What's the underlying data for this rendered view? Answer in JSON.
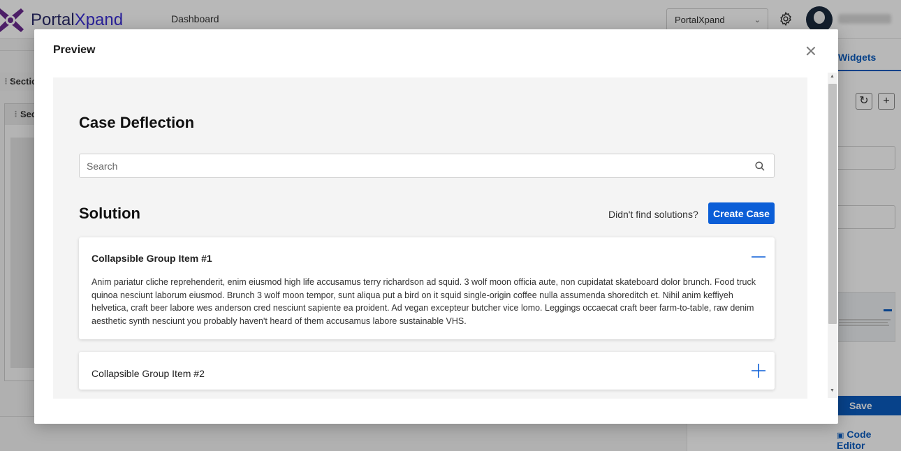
{
  "app": {
    "logo_text_prefix": "Portal",
    "logo_text_suffix": "Xpand",
    "nav_item": "Dashboard",
    "tenant_select_value": "PortalXpand",
    "left_section_label": "Sectio",
    "left_section_label_2": "Sec",
    "right_tab_label": "Widgets",
    "save_label": "Save",
    "code_editor_label": "Code Editor",
    "accent_color": "#0b5cbf"
  },
  "modal": {
    "title": "Preview",
    "content": {
      "heading": "Case Deflection",
      "search": {
        "placeholder": "Search",
        "value": ""
      },
      "solution_heading": "Solution",
      "prompt_text": "Didn't find solutions?",
      "create_case_label": "Create Case",
      "accordion": [
        {
          "title": "Collapsible Group Item #1",
          "expanded": true,
          "body": "Anim pariatur cliche reprehenderit, enim eiusmod high life accusamus terry richardson ad squid. 3 wolf moon officia aute, non cupidatat skateboard dolor brunch. Food truck quinoa nesciunt laborum eiusmod. Brunch 3 wolf moon tempor, sunt aliqua put a bird on it squid single-origin coffee nulla assumenda shoreditch et. Nihil anim keffiyeh helvetica, craft beer labore wes anderson cred nesciunt sapiente ea proident. Ad vegan excepteur butcher vice lomo. Leggings occaecat craft beer farm-to-table, raw denim aesthetic synth nesciunt you probably haven't heard of them accusamus labore sustainable VHS."
        },
        {
          "title": "Collapsible Group Item #2",
          "expanded": false
        }
      ]
    }
  },
  "icons": {
    "close": "close-icon",
    "search": "search-icon",
    "collapse": "minus-icon",
    "expand": "plus-icon",
    "settings": "gear-icon"
  }
}
